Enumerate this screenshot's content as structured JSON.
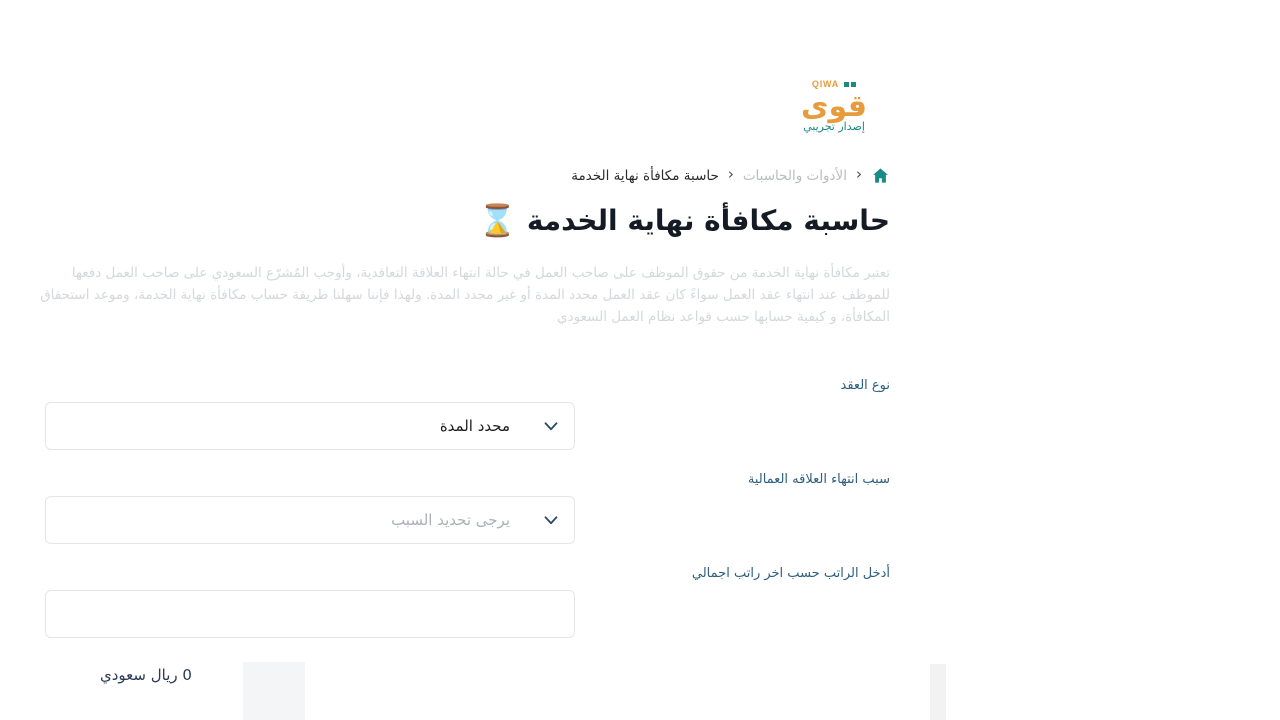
{
  "brand": {
    "logo_latin": "QIWA",
    "logo_arabic": "قوى",
    "logo_subtitle": "إصدار تجريبي",
    "orange": "#e89b3c",
    "teal": "#1a8a84"
  },
  "breadcrumb": {
    "home_icon": "home-icon",
    "separator": "‹",
    "items": [
      {
        "label": "الأدوات والحاسبات",
        "current": false
      },
      {
        "label": "حاسبة مكافأة نهاية الخدمة",
        "current": true
      }
    ]
  },
  "header": {
    "icon": "hourglass-icon",
    "icon_glyph": "⌛",
    "title": "حاسبة مكافأة نهاية الخدمة",
    "description": "تعتبر مكافأة نهاية الخدمة من حقوق الموظف على صاحب العمل في حالة انتهاء العلاقة التعاقدية، وأوجب المُشرّع السعودي على صاحب العمل دفعها للموظف عند انتهاء عقد العمل سواءً كان عقد العمل محدد المدة أو غير محدد المدة. ولهذا فإننا سهلنا طريقة حساب مكافأة نهاية الخدمة، وموعد استحقاق المكافأة، و كيفية حسابها حسب قواعد نظام العمل السعودي"
  },
  "form": {
    "contract_type": {
      "label": "نوع العقد",
      "value": "محدد المدة",
      "icon": "chevron-down-icon"
    },
    "termination_reason": {
      "label": "سبب انتهاء العلاقه العمالية",
      "placeholder": "يرجى تحديد السبب",
      "value": "يرجى تحديد السبب",
      "icon": "chevron-down-icon"
    },
    "salary": {
      "label": "أدخل الراتب حسب اخر راتب اجمالي",
      "value": "",
      "placeholder": ""
    }
  },
  "result": {
    "amount_text": "0 ريال سعودي"
  },
  "colors": {
    "label_blue": "#2e5f7e",
    "title_dark": "#151b24",
    "muted": "#d4d8dc",
    "border": "#e4e6e8"
  }
}
